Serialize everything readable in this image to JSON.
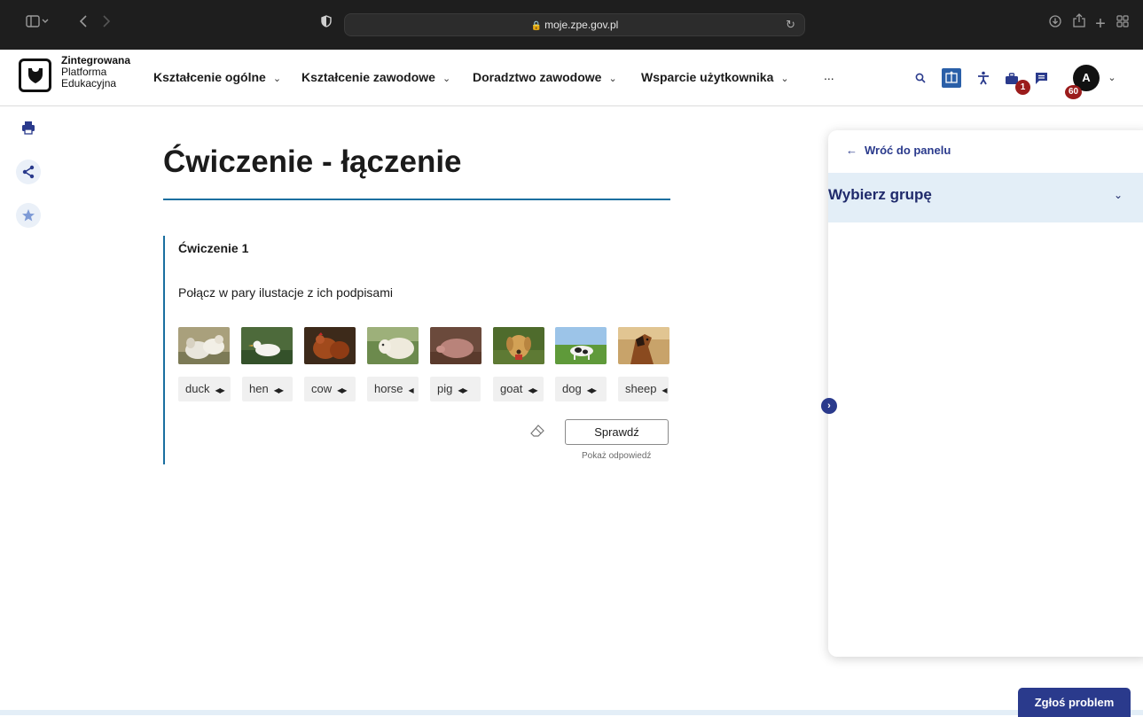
{
  "browser": {
    "url": "moje.zpe.gov.pl"
  },
  "header": {
    "logo_lines": [
      "Zintegrowana",
      "Platforma",
      "Edukacyjna"
    ],
    "nav": [
      {
        "label": "Kształcenie ogólne"
      },
      {
        "label": "Kształcenie zawodowe"
      },
      {
        "label": "Doradztwo zawodowe"
      },
      {
        "label": "Wsparcie użytkownika"
      }
    ],
    "more": "...",
    "briefcase_badge": "1",
    "avatar_letter": "A",
    "avatar_badge": "60"
  },
  "page": {
    "title": "Ćwiczenie - łączenie"
  },
  "exercise": {
    "heading": "Ćwiczenie 1",
    "instruction": "Połącz w pary ilustacje z ich podpisami",
    "pictures": [
      "sheep",
      "duck",
      "hen",
      "goat",
      "pig",
      "dog",
      "cow",
      "horse"
    ],
    "chips": [
      {
        "label": "duck",
        "arrows": "◀▶"
      },
      {
        "label": "hen",
        "arrows": "◀▶"
      },
      {
        "label": "cow",
        "arrows": "◀▶"
      },
      {
        "label": "horse",
        "arrows": "◀"
      },
      {
        "label": "pig",
        "arrows": "◀▶"
      },
      {
        "label": "goat",
        "arrows": "◀▶"
      },
      {
        "label": "dog",
        "arrows": "◀▶"
      },
      {
        "label": "sheep",
        "arrows": "◀"
      }
    ],
    "check_label": "Sprawdź",
    "show_answer_label": "Pokaż odpowiedź"
  },
  "panel": {
    "back_label": "Wróć do panelu",
    "group_label": "Wybierz grupę"
  },
  "report_label": "Zgłoś problem",
  "colors": {
    "accent": "#2a3a8c",
    "rule": "#1a6fa0",
    "badge": "#9b1c1c",
    "panel_header": "#e3eef7"
  }
}
